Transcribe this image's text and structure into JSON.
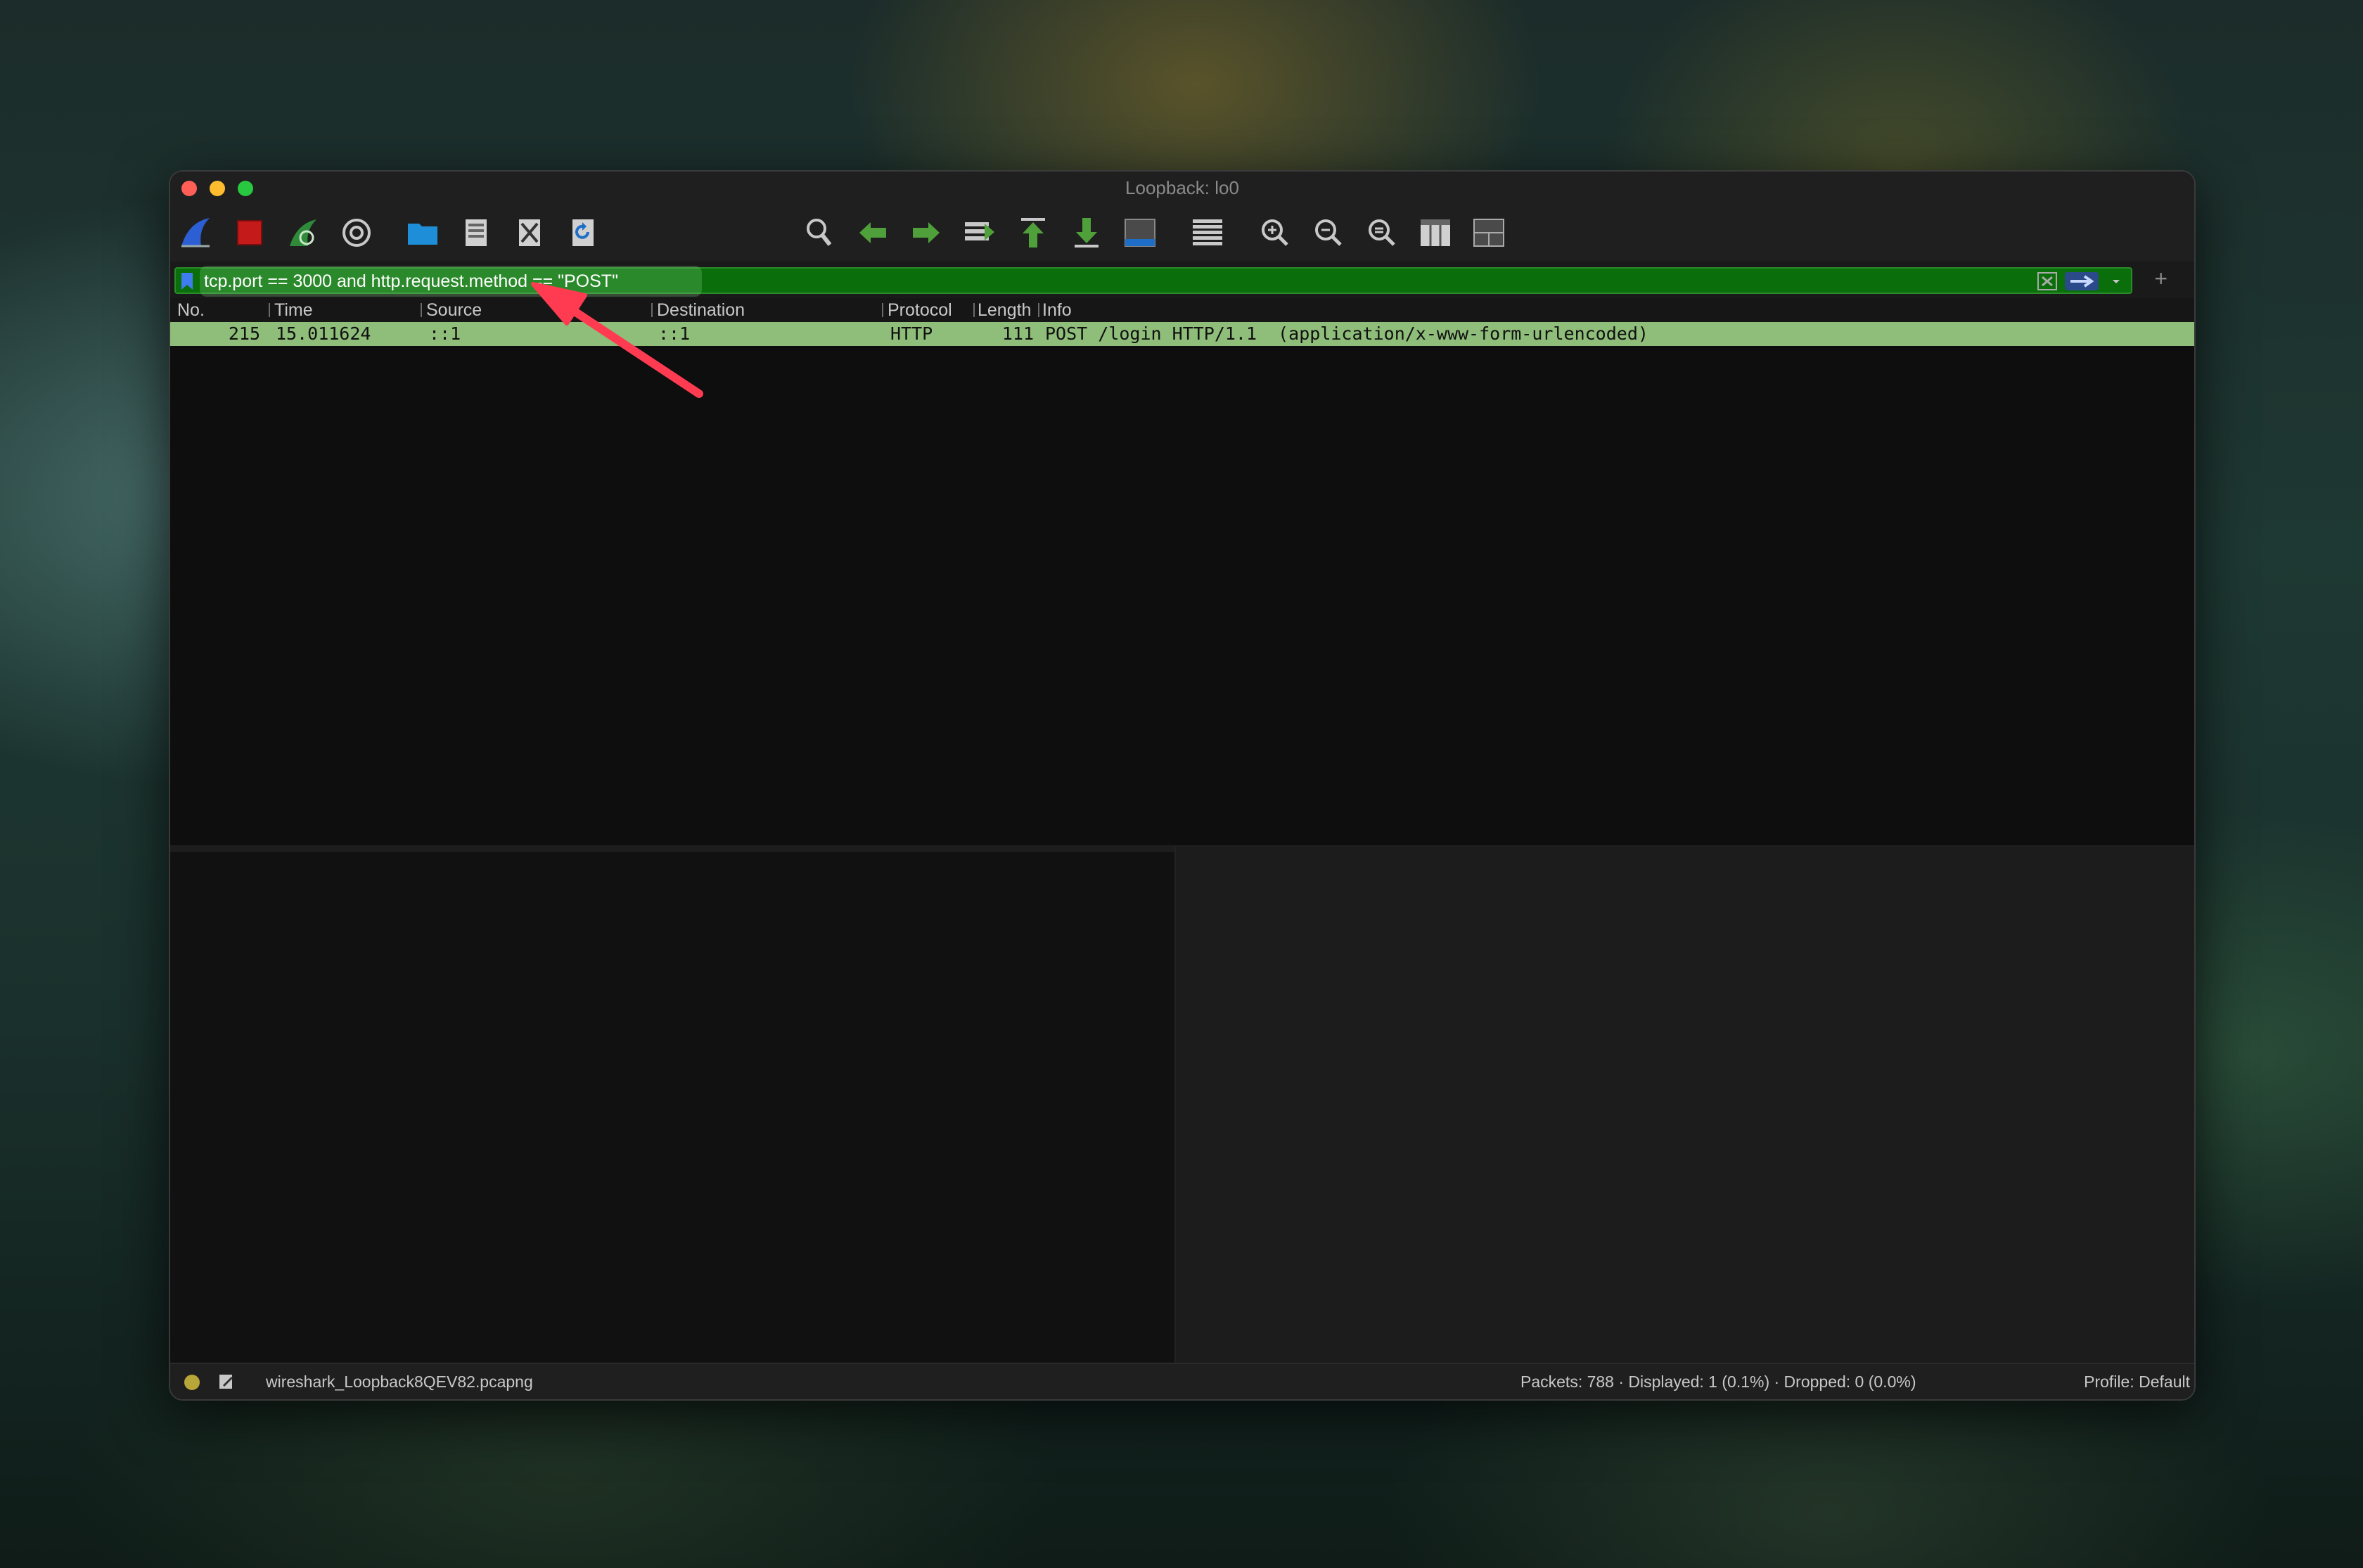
{
  "window": {
    "title": "Loopback: lo0"
  },
  "toolbar": {
    "buttons": [
      "start-capture-icon",
      "stop-capture-icon",
      "restart-capture-icon",
      "capture-options-icon",
      "open-file-icon",
      "save-file-icon",
      "close-file-icon",
      "reload-file-icon",
      "find-packet-icon",
      "go-back-icon",
      "go-forward-icon",
      "go-to-packet-icon",
      "first-packet-icon",
      "last-packet-icon",
      "auto-scroll-icon",
      "colorize-icon",
      "zoom-in-icon",
      "zoom-out-icon",
      "normal-size-icon",
      "resize-columns-icon",
      "layout-icon"
    ]
  },
  "filter": {
    "value": "tcp.port == 3000 and http.request.method == \"POST\"",
    "add_label": "+",
    "accent": "#0a6e0a"
  },
  "packet_list": {
    "columns": [
      "No.",
      "Time",
      "Source",
      "Destination",
      "Protocol",
      "Length",
      "Info"
    ],
    "rows": [
      {
        "no": "215",
        "time": "15.011624",
        "source": "::1",
        "destination": "::1",
        "protocol": "HTTP",
        "length": "111",
        "info": "POST /login HTTP/1.1  (application/x-www-form-urlencoded)"
      }
    ],
    "row_color": "#8fbd7a"
  },
  "status": {
    "file": "wireshark_Loopback8QEV82.pcapng",
    "stats": "Packets: 788 · Displayed: 1 (0.1%) · Dropped: 0 (0.0%)",
    "profile": "Profile: Default"
  }
}
